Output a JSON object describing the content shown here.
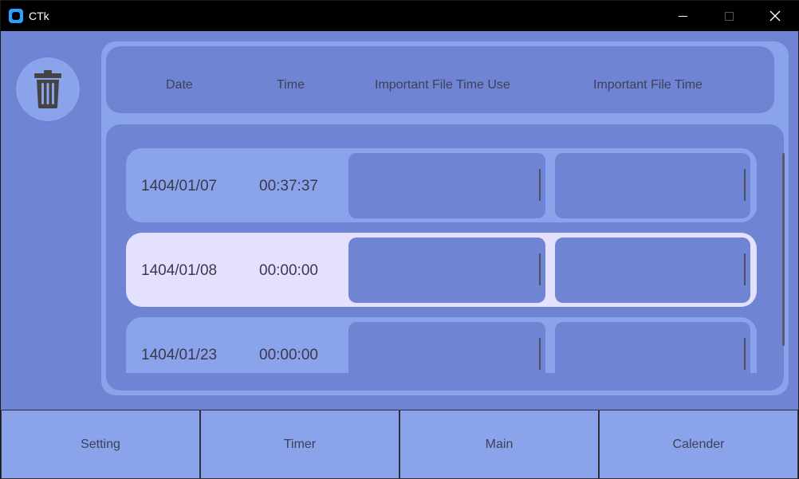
{
  "window": {
    "title": "CTk"
  },
  "titlebar": {
    "minimize_icon": "minimize-icon",
    "maximize_icon": "maximize-icon",
    "close_icon": "close-icon"
  },
  "trash": {
    "icon": "trash-icon"
  },
  "table": {
    "headers": [
      "Date",
      "Time",
      "Important File Time Use",
      "Important File Time"
    ],
    "rows": [
      {
        "date": "1404/01/07",
        "time": "00:37:37",
        "field1": "",
        "field2": "",
        "selected": false
      },
      {
        "date": "1404/01/08",
        "time": "00:00:00",
        "field1": "",
        "field2": "",
        "selected": true
      },
      {
        "date": "1404/01/23",
        "time": "00:00:00",
        "field1": "",
        "field2": "",
        "selected": false
      }
    ]
  },
  "nav": {
    "buttons": [
      "Setting",
      "Timer",
      "Main",
      "Calender"
    ]
  },
  "colors": {
    "background": "#6f85d4",
    "light": "#8aa3ea",
    "selected_row": "#e4e1ff",
    "titlebar": "#000000"
  }
}
